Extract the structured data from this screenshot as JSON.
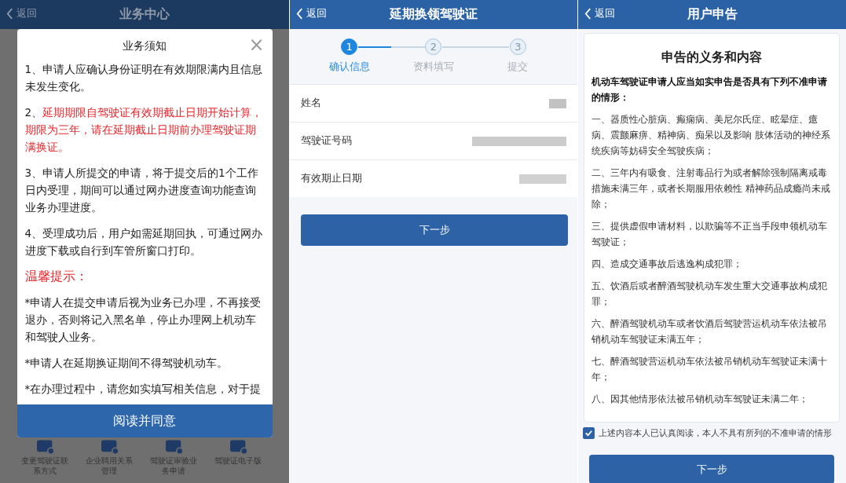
{
  "notice_screen": {
    "back": "返回",
    "title": "业务中心",
    "dialog": {
      "title": "业务须知",
      "close": "×",
      "paragraphs": [
        {
          "kind": "normal",
          "lead": "1、",
          "text": "申请人应确认身份证明在有效期限满内且信息未发生变化。"
        },
        {
          "kind": "warning",
          "lead": "2、",
          "text": "延期期限自驾驶证有效期截止日期开始计算，期限为三年，请在延期截止日期前办理驾驶证期满换证。"
        },
        {
          "kind": "normal",
          "lead": "3、",
          "text": "申请人所提交的申请，将于提交后的1个工作日内受理，期间可以通过网办进度查询功能查询业务办理进度。"
        },
        {
          "kind": "normal",
          "lead": "4、",
          "text": "受理成功后，用户如需延期回执，可通过网办进度下载或自行到车管所窗口打印。"
        },
        {
          "kind": "heading",
          "text": "温馨提示："
        },
        {
          "kind": "normal",
          "text": "*申请人在提交申请后视为业务已办理，不再接受退办，否则将记入黑名单，停止办理网上机动车和驾驶人业务。"
        },
        {
          "kind": "normal",
          "text": "*申请人在延期换证期间不得驾驶机动车。"
        },
        {
          "kind": "normal",
          "text": "*在办理过程中，请您如实填写相关信息，对于提"
        }
      ],
      "button": "阅读并同意"
    },
    "services": [
      {
        "label": "变更驾驶证联系方式"
      },
      {
        "label": "企业聘用关系管理"
      },
      {
        "label": "驾驶证审验业务申请"
      },
      {
        "label": "驾驶证电子版"
      }
    ]
  },
  "confirm_screen": {
    "back": "返回",
    "title": "延期换领驾驶证",
    "steps": [
      {
        "number": "1",
        "label": "确认信息",
        "selected": true
      },
      {
        "number": "2",
        "label": "资料填写",
        "selected": false
      },
      {
        "number": "3",
        "label": "提交",
        "selected": false
      }
    ],
    "fields": [
      {
        "label": "姓名"
      },
      {
        "label": "驾驶证号码"
      },
      {
        "label": "有效期止日期"
      }
    ],
    "button": "下一步"
  },
  "declaration_screen": {
    "back": "返回",
    "title": "用户申告",
    "card": {
      "title": "申告的义务和内容",
      "intro": "机动车驾驶证申请人应当如实申告是否具有下列不准申请的情形：",
      "items": [
        "一、器质性心脏病、癫痫病、美尼尔氏症、眩晕症、癔病、震颤麻痹、精神病、痴呆以及影响 肢体活动的神经系统疾病等妨碍安全驾驶疾病；",
        "二、三年内有吸食、注射毒品行为或者解除强制隔离戒毒措施未满三年，或者长期服用依赖性 精神药品成瘾尚未戒除；",
        "三、提供虚假申请材料，以欺骗等不正当手段申领机动车驾驶证；",
        "四、造成交通事故后逃逸构成犯罪；",
        "五、饮酒后或者醉酒驾驶机动车发生重大交通事故构成犯罪；",
        "六、醉酒驾驶机动车或者饮酒后驾驶营运机动车依法被吊销机动车驾驶证未满五年；",
        "七、醉酒驾驶营运机动车依法被吊销机动车驾驶证未满十年；",
        "八、因其他情形依法被吊销机动车驾驶证未满二年；"
      ]
    },
    "agree": {
      "label": "上述内容本人已认真阅读，本人不具有所列的不准申请的情形",
      "checked": true
    },
    "button": "下一步"
  }
}
